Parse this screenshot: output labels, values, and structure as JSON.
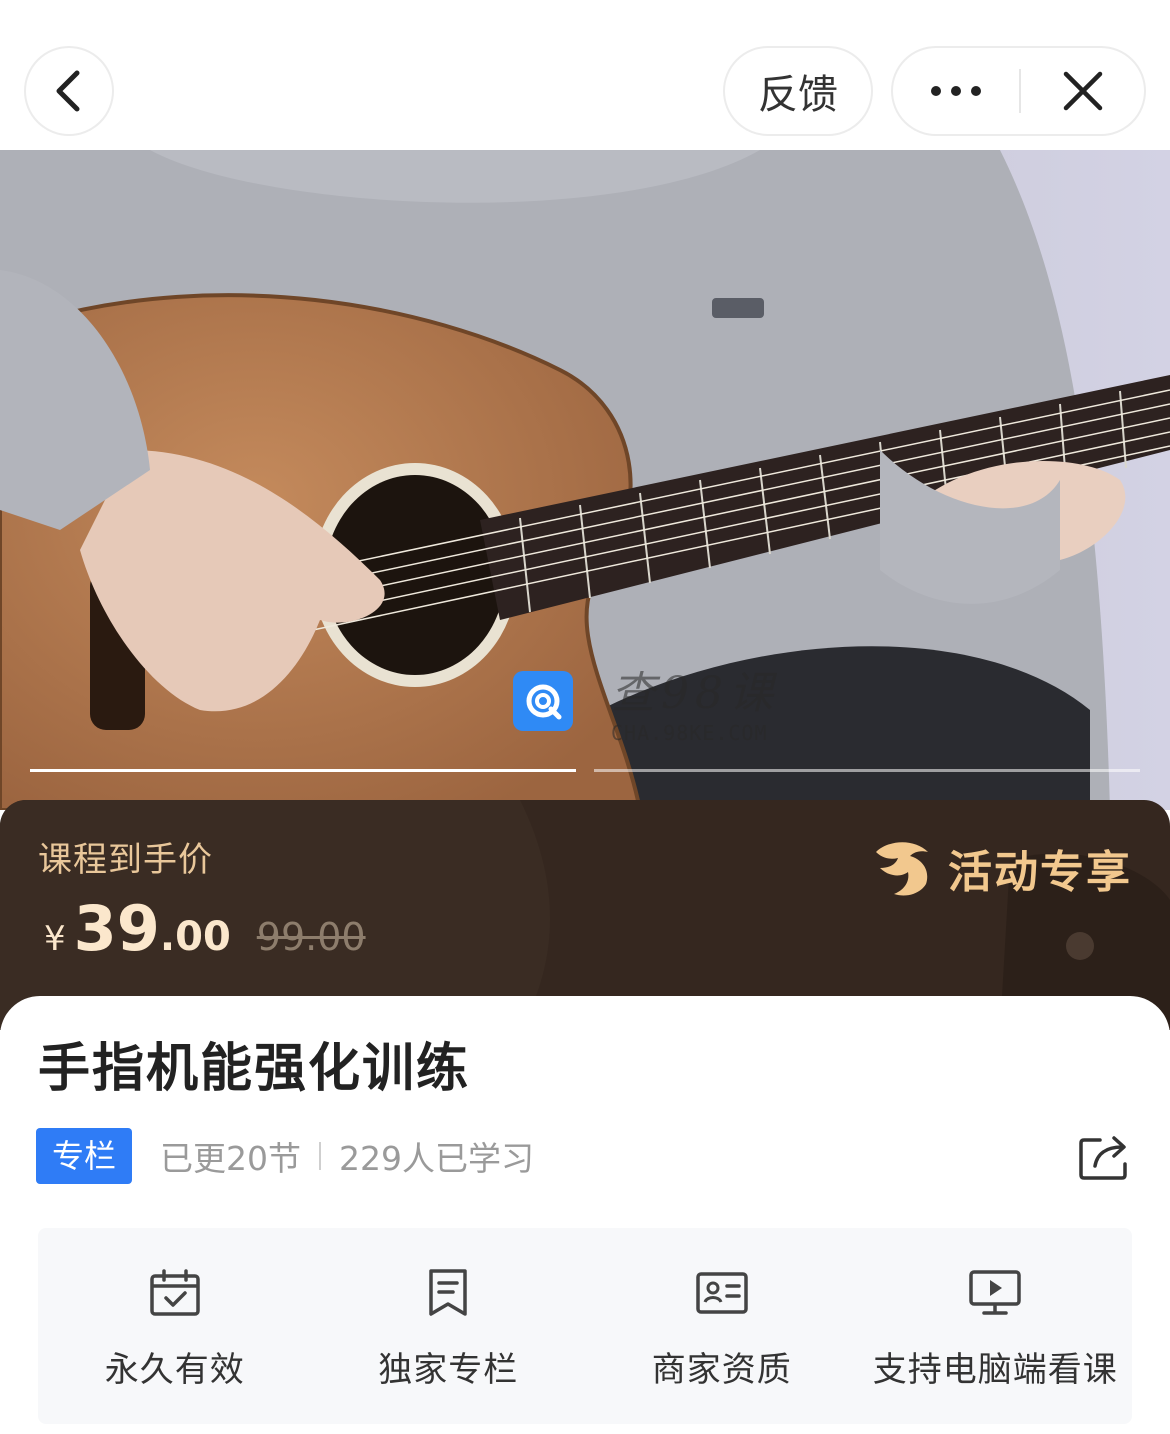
{
  "nav": {
    "back_icon": "chevron-left-icon",
    "feedback_label": "反馈",
    "more_icon": "more-dots-icon",
    "close_icon": "close-icon"
  },
  "hero": {
    "progress_segments": [
      {
        "state": "active"
      },
      {
        "state": "inactive"
      }
    ],
    "watermark": {
      "cn": "查98课",
      "en": "CHA.98KE.COM"
    }
  },
  "price": {
    "label": "课程到手价",
    "currency": "¥",
    "amount_int": "39",
    "amount_dec": ".00",
    "original": "99.00",
    "promo_label": "活动专享",
    "promo_icon": "bird-logo-icon"
  },
  "course": {
    "title": "手指机能强化训练",
    "tag": "专栏",
    "updated": "已更20节",
    "learners": "229人已学习",
    "share_icon": "share-icon"
  },
  "features": [
    {
      "icon": "calendar-check-icon",
      "label": "永久有效"
    },
    {
      "icon": "bookmark-icon",
      "label": "独家专栏"
    },
    {
      "icon": "id-card-icon",
      "label": "商家资质"
    },
    {
      "icon": "monitor-play-icon",
      "label": "支持电脑端看课"
    }
  ],
  "colors": {
    "accent_blue": "#2f7cf6",
    "price_band": "#35271f",
    "price_gold": "#f2c88e"
  }
}
